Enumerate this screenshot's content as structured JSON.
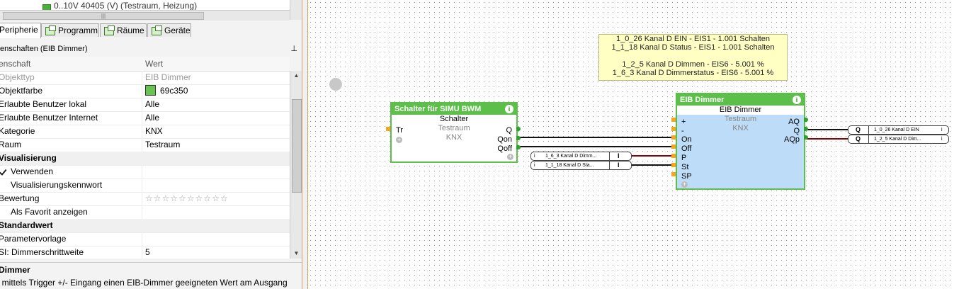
{
  "tree": {
    "item_label": "0..10V 40405 (V) (Testraum, Heizung)",
    "item_color": "#4caf3b"
  },
  "tabs": [
    {
      "label": "Peripherie",
      "active": true
    },
    {
      "label": "Programm"
    },
    {
      "label": "Räume"
    },
    {
      "label": "Geräte"
    }
  ],
  "props": {
    "header": "enschaften (EIB Dimmer)",
    "pin_icon": "pin-icon",
    "col_key": "enschaft",
    "col_value": "Wert",
    "rows": [
      {
        "key": "Objekttyp",
        "value": "EIB Dimmer"
      },
      {
        "key": "Objektfarbe",
        "value": "69c350",
        "color": "#69c350"
      },
      {
        "key": "Erlaubte Benutzer lokal",
        "value": "Alle"
      },
      {
        "key": "Erlaubte Benutzer Internet",
        "value": "Alle"
      },
      {
        "key": "Kategorie",
        "value": "KNX"
      },
      {
        "key": "Raum",
        "value": "Testraum"
      },
      {
        "key": "Visualisierung",
        "value": ""
      },
      {
        "key": "Verwenden",
        "value": "",
        "checked": true
      },
      {
        "key": "Visualisierungskennwort",
        "value": ""
      },
      {
        "key": "Bewertung",
        "value": "☆☆☆☆☆☆☆☆☆☆",
        "rating": 0
      },
      {
        "key": "Als Favorit anzeigen",
        "value": "",
        "checked": false
      },
      {
        "key": "Standardwert",
        "value": ""
      },
      {
        "key": "Parametervorlage",
        "value": ""
      },
      {
        "key": "SI: Dimmerschrittweite",
        "value": "5"
      }
    ]
  },
  "description": {
    "title": "Dimmer",
    "text": "t mittels Trigger +/- Eingang einen EIB-Dimmer geeigneten Wert am Ausgang"
  },
  "comment_lines": [
    "1_0_26 Kanal D EIN - EIS1 - 1.001 Schalten",
    "1_1_18 Kanal D Status  - EIS1 - 1.001 Schalten",
    "",
    "1_2_5 Kanal D Dimmen - EIS6 - 5.001 %",
    "1_6_3 Kanal D Dimmerstatus - EIS6 - 5.001 %"
  ],
  "block_schalter": {
    "title": "Schalter für SIMU BWM",
    "type": "Schalter",
    "room": "Testraum",
    "category": "KNX",
    "input": "Tr",
    "outputs": [
      "Q",
      "Qon",
      "Qoff"
    ],
    "color": "#5cbf4a"
  },
  "block_dimmer": {
    "title": "EIB Dimmer",
    "type": "EIB Dimmer",
    "room": "Testraum",
    "category": "KNX",
    "inputs": [
      "+",
      "-",
      "On",
      "Off",
      "P",
      "St",
      "SP"
    ],
    "outputs": [
      "AQ",
      "Q",
      "AQp"
    ],
    "add": "+",
    "fill": "#bddcf7"
  },
  "refs_in": [
    {
      "icon": "i",
      "label": "1_6_3  Kanal  D  Dimm...",
      "flag": "I"
    },
    {
      "icon": "i",
      "label": "1_1_18  Kanal  D  Sta...",
      "flag": "I"
    }
  ],
  "refs_out": [
    {
      "flag": "Q",
      "label": "1_0_26 Kanal D EIN",
      "icon": "i"
    },
    {
      "flag": "Q",
      "label": "1_2_5 Kanal D Dim...",
      "icon": "i"
    }
  ],
  "wire_colors": {
    "bool": "#111111",
    "value": "#8b0000"
  }
}
